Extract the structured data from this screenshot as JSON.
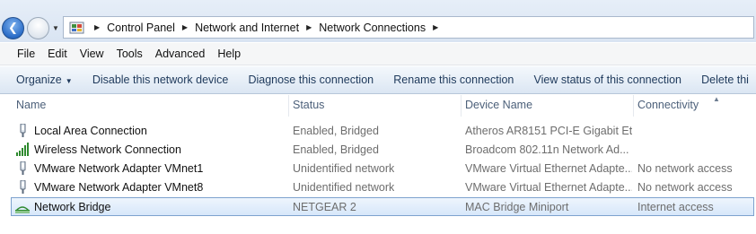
{
  "breadcrumb": [
    "Control Panel",
    "Network and Internet",
    "Network Connections"
  ],
  "menu": [
    "File",
    "Edit",
    "View",
    "Tools",
    "Advanced",
    "Help"
  ],
  "commands": {
    "organize": "Organize",
    "items": [
      "Disable this network device",
      "Diagnose this connection",
      "Rename this connection",
      "View status of this connection",
      "Delete thi"
    ]
  },
  "columns": [
    "Name",
    "Status",
    "Device Name",
    "Connectivity"
  ],
  "rows": [
    {
      "name": "Local Area Connection",
      "status": "Enabled, Bridged",
      "device": "Atheros AR8151 PCI-E Gigabit Et...",
      "connectivity": "",
      "icon": "ethernet-adapter-icon"
    },
    {
      "name": "Wireless Network Connection",
      "status": "Enabled, Bridged",
      "device": "Broadcom 802.11n Network Ad...",
      "connectivity": "",
      "icon": "wireless-signal-icon"
    },
    {
      "name": "VMware Network Adapter VMnet1",
      "status": "Unidentified network",
      "device": "VMware Virtual Ethernet Adapte...",
      "connectivity": "No network access",
      "icon": "ethernet-adapter-icon"
    },
    {
      "name": "VMware Network Adapter VMnet8",
      "status": "Unidentified network",
      "device": "VMware Virtual Ethernet Adapte...",
      "connectivity": "No network access",
      "icon": "ethernet-adapter-icon"
    },
    {
      "name": "Network Bridge",
      "status": "NETGEAR  2",
      "device": "MAC Bridge Miniport",
      "connectivity": "Internet access",
      "icon": "network-bridge-icon",
      "selected": true
    }
  ],
  "colors": {
    "accent": "#2a6cc7",
    "selection": "#d7e7fa",
    "selection_border": "#7da2ce",
    "command_text": "#1e395b"
  }
}
